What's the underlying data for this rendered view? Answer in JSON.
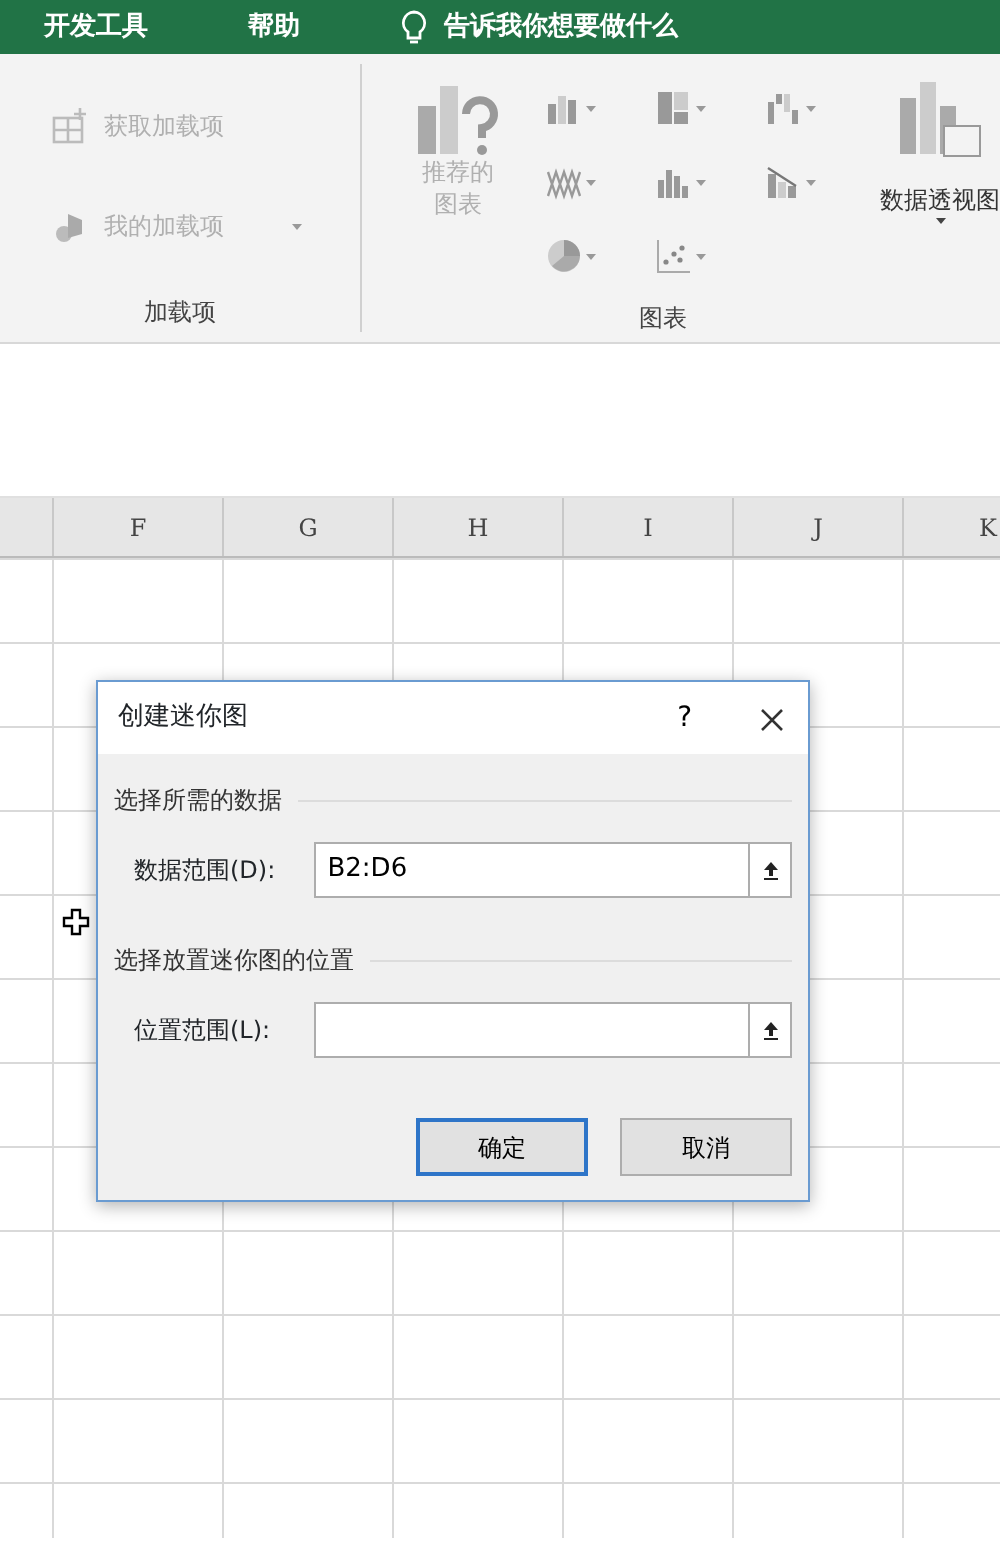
{
  "tabs": [
    {
      "label": "开发工具"
    },
    {
      "label": "帮助"
    }
  ],
  "tell_me": {
    "placeholder": "告诉我你想要做什么"
  },
  "addins_group": {
    "label": "加载项",
    "items": [
      {
        "kind": "get",
        "label": "获取加载项",
        "disabled": true,
        "dropdown": false
      },
      {
        "kind": "mine",
        "label": "我的加载项",
        "disabled": true,
        "dropdown": true
      }
    ]
  },
  "charts_group": {
    "label": "图表",
    "recommended": {
      "label": "推荐的图表",
      "disabled": true
    },
    "chart_buttons": [
      {
        "kind": "column"
      },
      {
        "kind": "hierarchy"
      },
      {
        "kind": "waterfall"
      },
      {
        "kind": "line"
      },
      {
        "kind": "statistic"
      },
      {
        "kind": "combo"
      },
      {
        "kind": "pie"
      },
      {
        "kind": "scatter"
      }
    ],
    "pivot_chart": {
      "label": "数据透视图"
    }
  },
  "columns": [
    "F",
    "G",
    "H",
    "I",
    "J",
    "K"
  ],
  "dialog": {
    "title": "创建迷你图",
    "help": "?",
    "sections": [
      {
        "heading": "选择所需的数据",
        "label": "数据范围(D):",
        "value": "B2:D6"
      },
      {
        "heading": "选择放置迷你图的位置",
        "label": "位置范围(L):"
      }
    ],
    "buttons": [
      {
        "label": "确定",
        "default": true
      },
      {
        "label": "取消",
        "default": false
      }
    ]
  }
}
